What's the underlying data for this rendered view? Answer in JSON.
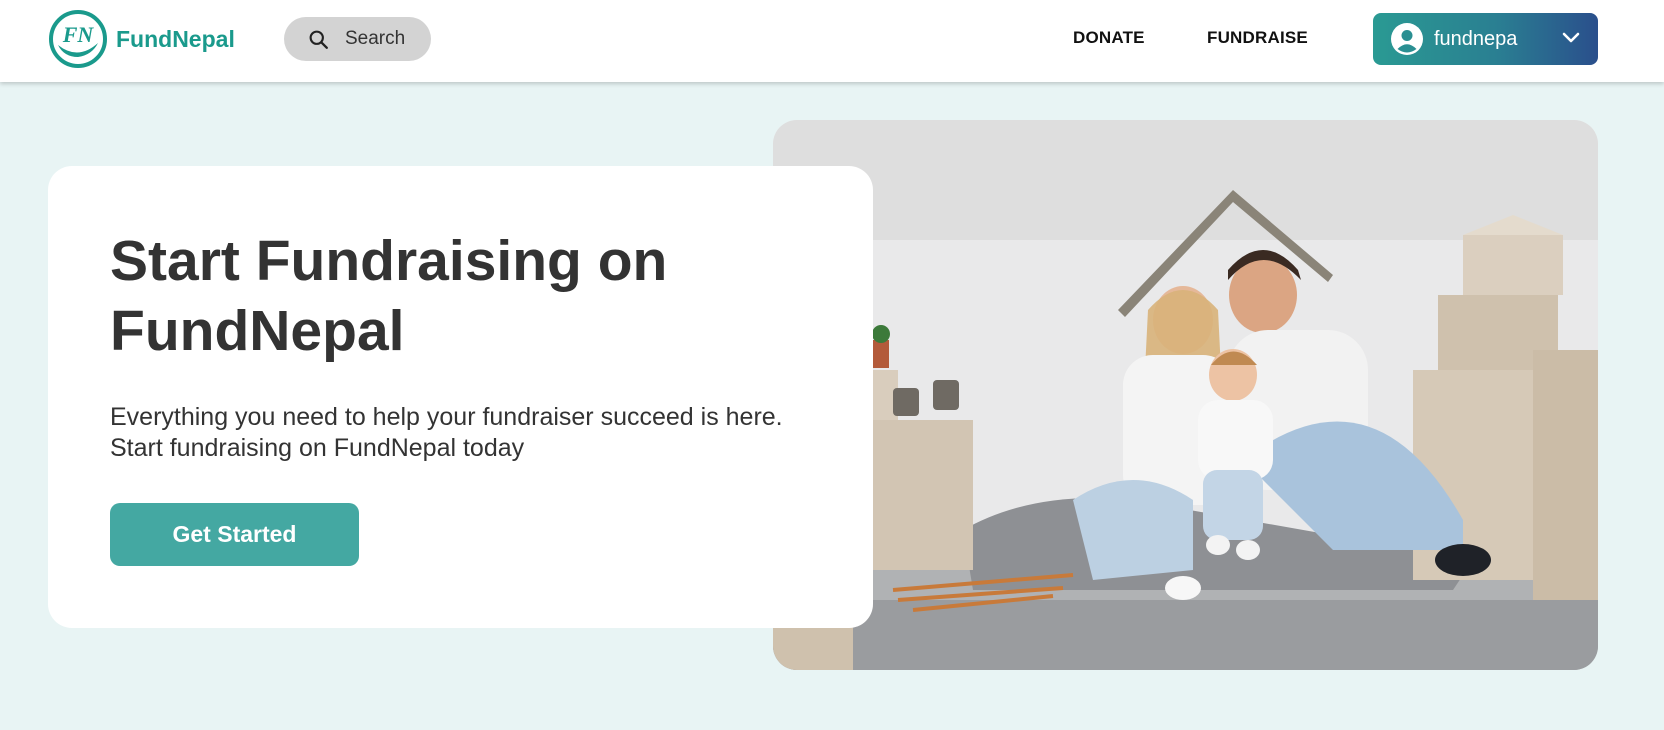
{
  "brand": {
    "name": "FundNepal",
    "logo_letters": "FN",
    "color": "#1a9a8c"
  },
  "search": {
    "label": "Search",
    "icon": "search-icon"
  },
  "nav": {
    "donate": "DONATE",
    "fundraise": "FUNDRAISE"
  },
  "user": {
    "name": "fundnepa",
    "icon": "user-avatar-icon",
    "chevron": "chevron-down-icon"
  },
  "hero": {
    "title": "Start Fundraising on FundNepal",
    "subtitle": "Everything you need to help your fundraiser succeed is here. Start fundraising on FundNepal today",
    "cta": "Get Started",
    "image": "family-under-cardboard-roof-photo"
  },
  "colors": {
    "accent": "#44a8a2",
    "page_bg": "#e8f4f4",
    "text": "#333333",
    "user_gradient_start": "#2a9a93",
    "user_gradient_end": "#2a4f8c"
  }
}
